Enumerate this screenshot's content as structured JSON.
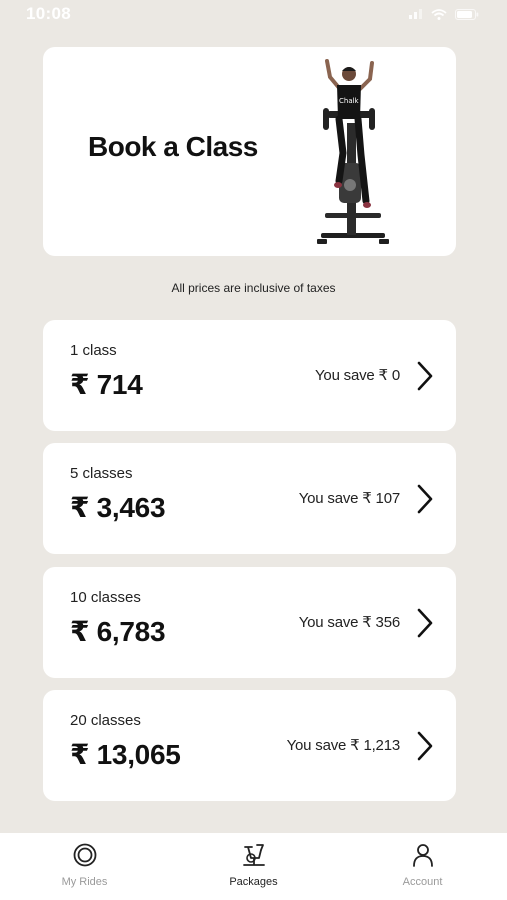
{
  "status_bar": {
    "time": "10:08"
  },
  "hero": {
    "title": "Book a Class",
    "shirt_text": "Chalk"
  },
  "tax_note": "All prices are inclusive of taxes",
  "packages": [
    {
      "label": "1 class",
      "price": "₹ 714",
      "savings": "You save ₹ 0"
    },
    {
      "label": "5 classes",
      "price": "₹ 3,463",
      "savings": "You save ₹ 107"
    },
    {
      "label": "10 classes",
      "price": "₹ 6,783",
      "savings": "You save ₹ 356"
    },
    {
      "label": "20 classes",
      "price": "₹ 13,065",
      "savings": "You save ₹ 1,213"
    }
  ],
  "nav": {
    "items": [
      {
        "label": "My Rides",
        "icon": "rides-icon",
        "active": false
      },
      {
        "label": "Packages",
        "icon": "bike-icon",
        "active": true
      },
      {
        "label": "Account",
        "icon": "person-icon",
        "active": false
      }
    ]
  }
}
